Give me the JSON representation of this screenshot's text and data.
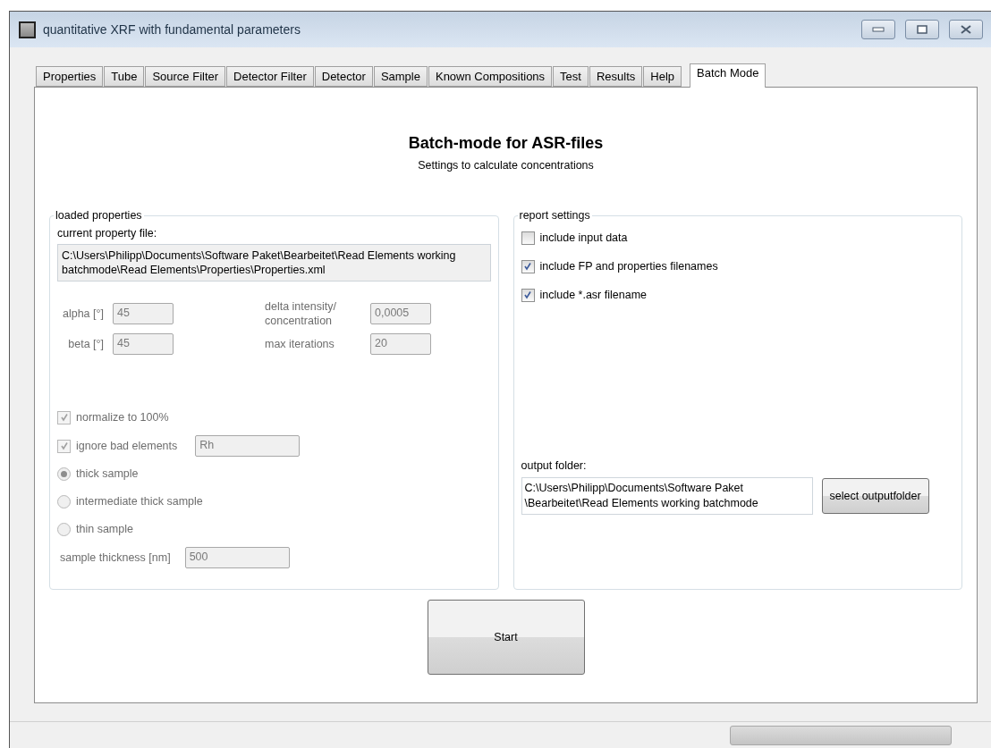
{
  "window": {
    "title": "quantitative XRF with fundamental parameters"
  },
  "tabs": [
    {
      "label": "Properties",
      "selected": false
    },
    {
      "label": "Tube",
      "selected": false
    },
    {
      "label": "Source Filter",
      "selected": false
    },
    {
      "label": "Detector Filter",
      "selected": false
    },
    {
      "label": "Detector",
      "selected": false
    },
    {
      "label": "Sample",
      "selected": false
    },
    {
      "label": "Known Compositions",
      "selected": false
    },
    {
      "label": "Test",
      "selected": false
    },
    {
      "label": "Results",
      "selected": false
    },
    {
      "label": "Help",
      "selected": false
    },
    {
      "label": "Batch Mode",
      "selected": true
    }
  ],
  "heading": "Batch-mode for ASR-files",
  "subheading": "Settings to calculate concentrations",
  "loaded_properties": {
    "title": "loaded properties",
    "file_label": "current property file:",
    "file_path": "C:\\Users\\Philipp\\Documents\\Software Paket\\Bearbeitet\\Read Elements working batchmode\\Read Elements\\Properties\\Properties.xml",
    "params": [
      {
        "label": "alpha [°]",
        "value": "45"
      },
      {
        "label": "delta intensity/ concentration",
        "value": "0,0005"
      },
      {
        "label": "beta [°]",
        "value": "45"
      },
      {
        "label": "max iterations",
        "value": "20"
      }
    ],
    "normalize": {
      "label": "normalize to 100%",
      "checked": true,
      "disabled": true
    },
    "ignore_bad": {
      "label": "ignore bad elements",
      "checked": true,
      "disabled": true,
      "value": "Rh"
    },
    "sample_types": [
      {
        "label": "thick sample",
        "selected": true
      },
      {
        "label": "intermediate thick sample",
        "selected": false
      },
      {
        "label": "thin sample",
        "selected": false
      }
    ],
    "thickness": {
      "label": "sample thickness [nm]",
      "value": "500"
    }
  },
  "report_settings": {
    "title": "report settings",
    "options": [
      {
        "label": "include input data",
        "checked": false
      },
      {
        "label": "include FP and properties filenames",
        "checked": true
      },
      {
        "label": "include *.asr filename",
        "checked": true
      }
    ],
    "output_label": "output folder:",
    "output_path": "C:\\Users\\Philipp\\Documents\\Software Paket\n\\Bearbeitet\\Read Elements working batchmode",
    "select_button": "select outputfolder"
  },
  "start_button": "Start",
  "status_bar": {
    "progress": {
      "level": 0
    }
  }
}
